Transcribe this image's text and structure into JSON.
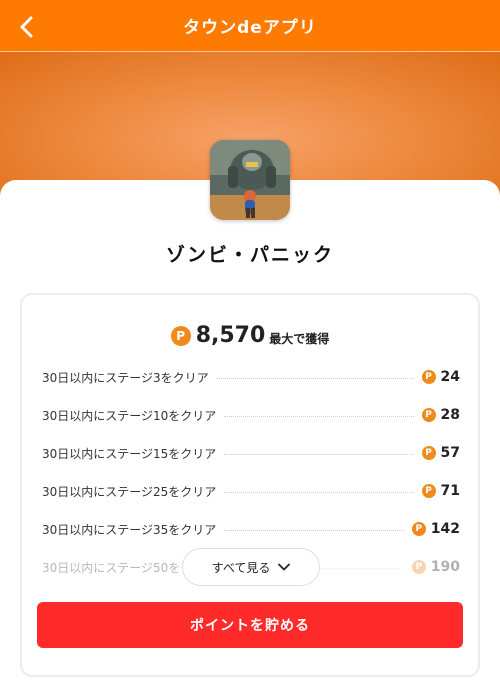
{
  "header": {
    "title": "タウンdeアプリ"
  },
  "app": {
    "name": "ゾンビ・パニック"
  },
  "colors": {
    "brand": "#ff7a00",
    "cta": "#ff2a2a",
    "coin": "#f08a1c"
  },
  "points": {
    "coin_symbol": "P",
    "total": "8,570",
    "total_suffix": "最大で獲得",
    "tasks": [
      {
        "label": "30日以内にステージ3をクリア",
        "value": "24"
      },
      {
        "label": "30日以内にステージ10をクリア",
        "value": "28"
      },
      {
        "label": "30日以内にステージ15をクリア",
        "value": "57"
      },
      {
        "label": "30日以内にステージ25をクリア",
        "value": "71"
      },
      {
        "label": "30日以内にステージ35をクリア",
        "value": "142"
      },
      {
        "label": "30日以内にステージ50をクリア",
        "value": "190"
      }
    ]
  },
  "see_all": {
    "label": "すべて見る"
  },
  "cta": {
    "label": "ポイントを貯める"
  }
}
